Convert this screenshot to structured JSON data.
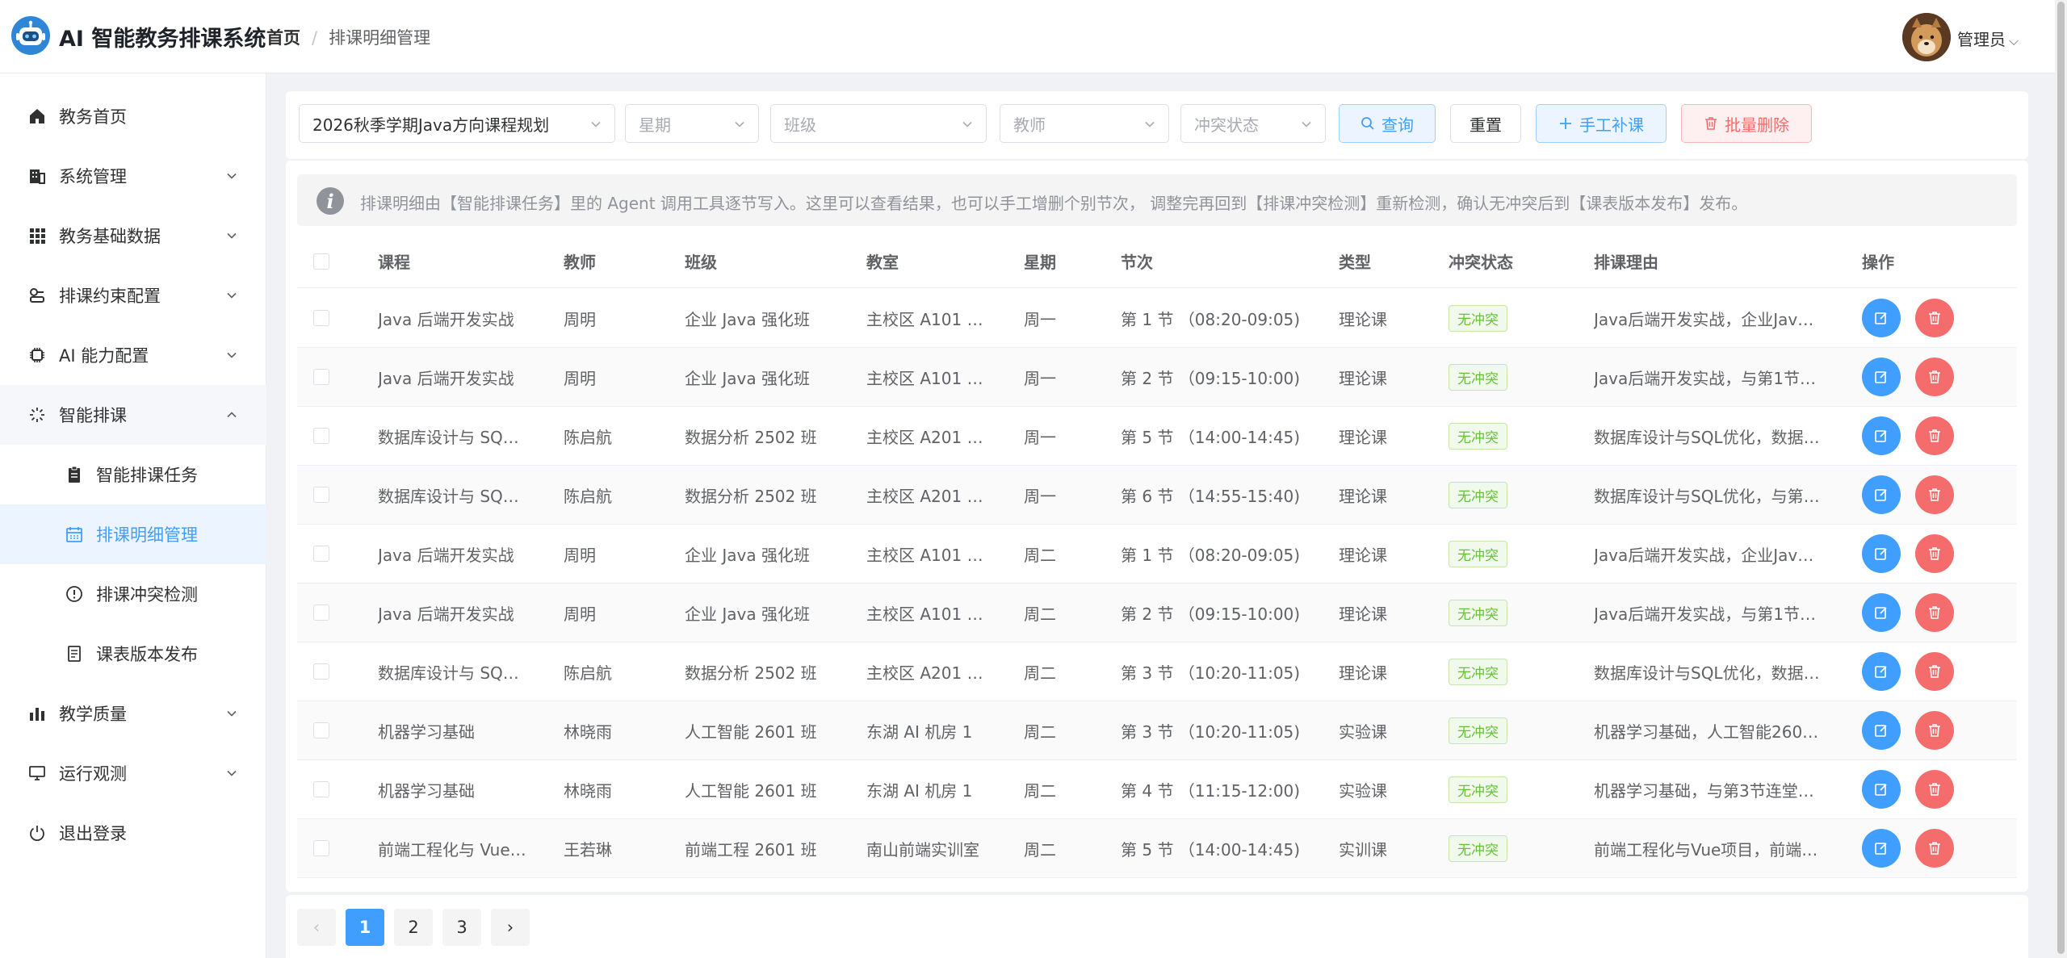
{
  "app": {
    "title": "AI 智能教务排课系统"
  },
  "breadcrumb": {
    "home": "首页",
    "separator": "/",
    "current": "排课明细管理"
  },
  "user": {
    "name": "管理员"
  },
  "sidebar": {
    "items": [
      {
        "label": "教务首页",
        "icon": "home-icon"
      },
      {
        "label": "系统管理",
        "icon": "building-icon"
      },
      {
        "label": "教务基础数据",
        "icon": "grid-icon"
      },
      {
        "label": "排课约束配置",
        "icon": "constraint-icon"
      },
      {
        "label": "AI 能力配置",
        "icon": "chip-icon"
      },
      {
        "label": "智能排课",
        "icon": "sparkle-icon"
      },
      {
        "label": "智能排课任务",
        "icon": "clipboard-icon"
      },
      {
        "label": "排课明细管理",
        "icon": "calendar-icon"
      },
      {
        "label": "排课冲突检测",
        "icon": "warning-circle-icon"
      },
      {
        "label": "课表版本发布",
        "icon": "document-icon"
      },
      {
        "label": "教学质量",
        "icon": "bar-chart-icon"
      },
      {
        "label": "运行观测",
        "icon": "monitor-icon"
      },
      {
        "label": "退出登录",
        "icon": "power-icon"
      }
    ]
  },
  "filters": {
    "plan": "2026秋季学期Java方向课程规划",
    "weekday_placeholder": "星期",
    "class_placeholder": "班级",
    "teacher_placeholder": "教师",
    "conflict_placeholder": "冲突状态",
    "query_label": "查询",
    "reset_label": "重置",
    "add_label": "手工补课",
    "batch_delete_label": "批量删除"
  },
  "notice": "排课明细由【智能排课任务】里的 Agent 调用工具逐节写入。这里可以查看结果，也可以手工增删个别节次， 调整完再回到【排课冲突检测】重新检测，确认无冲突后到【课表版本发布】发布。",
  "table": {
    "headers": [
      "课程",
      "教师",
      "班级",
      "教室",
      "星期",
      "节次",
      "类型",
      "冲突状态",
      "排课理由",
      "操作"
    ],
    "rows": [
      {
        "course": "Java 后端开发实战",
        "teacher": "周明",
        "class": "企业 Java 强化班",
        "room": "主校区 A101 …",
        "day": "周一",
        "period": "第 1 节 （08:20-09:05)",
        "type": "理论课",
        "status": "无冲突",
        "reason": "Java后端开发实战，企业Jav…"
      },
      {
        "course": "Java 后端开发实战",
        "teacher": "周明",
        "class": "企业 Java 强化班",
        "room": "主校区 A101 …",
        "day": "周一",
        "period": "第 2 节 （09:15-10:00)",
        "type": "理论课",
        "status": "无冲突",
        "reason": "Java后端开发实战，与第1节…"
      },
      {
        "course": "数据库设计与 SQ…",
        "teacher": "陈启航",
        "class": "数据分析 2502 班",
        "room": "主校区 A201 …",
        "day": "周一",
        "period": "第 5 节 （14:00-14:45)",
        "type": "理论课",
        "status": "无冲突",
        "reason": "数据库设计与SQL优化，数据…"
      },
      {
        "course": "数据库设计与 SQ…",
        "teacher": "陈启航",
        "class": "数据分析 2502 班",
        "room": "主校区 A201 …",
        "day": "周一",
        "period": "第 6 节 （14:55-15:40)",
        "type": "理论课",
        "status": "无冲突",
        "reason": "数据库设计与SQL优化，与第…"
      },
      {
        "course": "Java 后端开发实战",
        "teacher": "周明",
        "class": "企业 Java 强化班",
        "room": "主校区 A101 …",
        "day": "周二",
        "period": "第 1 节 （08:20-09:05)",
        "type": "理论课",
        "status": "无冲突",
        "reason": "Java后端开发实战，企业Jav…"
      },
      {
        "course": "Java 后端开发实战",
        "teacher": "周明",
        "class": "企业 Java 强化班",
        "room": "主校区 A101 …",
        "day": "周二",
        "period": "第 2 节 （09:15-10:00)",
        "type": "理论课",
        "status": "无冲突",
        "reason": "Java后端开发实战，与第1节…"
      },
      {
        "course": "数据库设计与 SQ…",
        "teacher": "陈启航",
        "class": "数据分析 2502 班",
        "room": "主校区 A201 …",
        "day": "周二",
        "period": "第 3 节 （10:20-11:05)",
        "type": "理论课",
        "status": "无冲突",
        "reason": "数据库设计与SQL优化，数据…"
      },
      {
        "course": "机器学习基础",
        "teacher": "林晓雨",
        "class": "人工智能 2601 班",
        "room": "东湖 AI 机房 1",
        "day": "周二",
        "period": "第 3 节 （10:20-11:05)",
        "type": "实验课",
        "status": "无冲突",
        "reason": "机器学习基础，人工智能260…"
      },
      {
        "course": "机器学习基础",
        "teacher": "林晓雨",
        "class": "人工智能 2601 班",
        "room": "东湖 AI 机房 1",
        "day": "周二",
        "period": "第 4 节 （11:15-12:00)",
        "type": "实验课",
        "status": "无冲突",
        "reason": "机器学习基础，与第3节连堂…"
      },
      {
        "course": "前端工程化与 Vue…",
        "teacher": "王若琳",
        "class": "前端工程 2601 班",
        "room": "南山前端实训室",
        "day": "周二",
        "period": "第 5 节 （14:00-14:45)",
        "type": "实训课",
        "status": "无冲突",
        "reason": "前端工程化与Vue项目，前端…"
      }
    ]
  },
  "pagination": {
    "pages": [
      "1",
      "2",
      "3"
    ],
    "current": "1",
    "prev": "‹",
    "next": "›"
  },
  "colors": {
    "primary": "#409eff",
    "danger": "#f56c6c",
    "success": "#67c23a"
  }
}
